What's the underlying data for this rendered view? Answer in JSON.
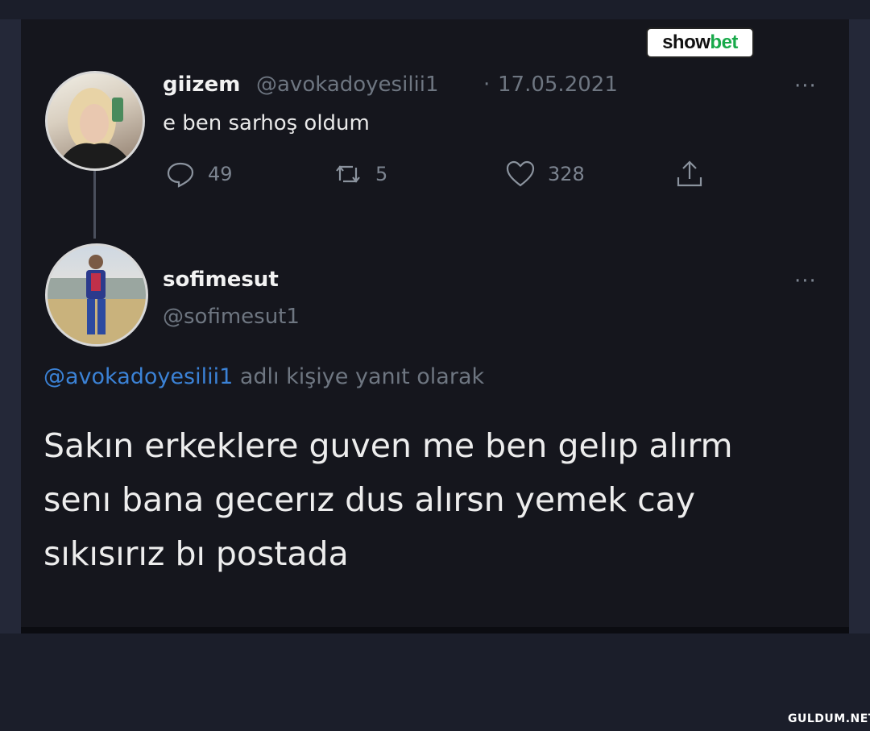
{
  "brand": {
    "part1": "show",
    "part2": "bet"
  },
  "tweet": {
    "name": "giizem",
    "handle": "@avokadoyesilii1",
    "separator": "·",
    "date": "17.05.2021",
    "text": "e ben sarhoş oldum",
    "more": "···",
    "actions": {
      "replies": "49",
      "retweets": "5",
      "likes": "328"
    }
  },
  "reply": {
    "name": "sofimesut",
    "handle": "@sofimesut1",
    "more": "···",
    "replying_mention": "@avokadoyesilii1",
    "replying_suffix": " adlı kişiye yanıt olarak",
    "lines": [
      "Sakın erkeklere guven me ben gelıp alırm",
      "senı bana gecerız dus alırsn yemek cay",
      "sıkısırız bı postada"
    ]
  },
  "watermark": "GULDUM.NET",
  "colors": {
    "background": "#15161d",
    "mention": "#3b82d6",
    "brand_green": "#18a94a"
  }
}
